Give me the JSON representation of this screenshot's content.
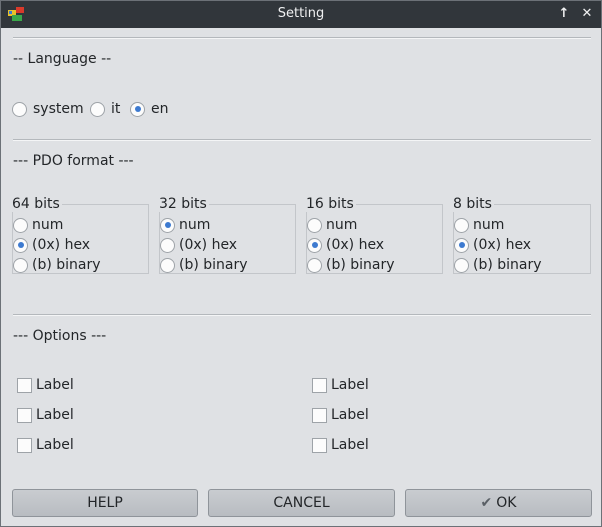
{
  "window": {
    "title": "Setting"
  },
  "language": {
    "section_title": "-- Language --",
    "options": [
      {
        "label": "system",
        "selected": false
      },
      {
        "label": "it",
        "selected": false
      },
      {
        "label": "en",
        "selected": true
      }
    ]
  },
  "pdo": {
    "section_title": "--- PDO format ---",
    "groups": [
      {
        "title": "64 bits",
        "options": [
          "num",
          "(0x) hex",
          "(b) binary"
        ],
        "selected": "(0x) hex"
      },
      {
        "title": "32 bits",
        "options": [
          "num",
          "(0x) hex",
          "(b) binary"
        ],
        "selected": "num"
      },
      {
        "title": "16 bits",
        "options": [
          "num",
          "(0x) hex",
          "(b) binary"
        ],
        "selected": "(0x) hex"
      },
      {
        "title": "8 bits",
        "options": [
          "num",
          "(0x) hex",
          "(b) binary"
        ],
        "selected": "(0x) hex"
      }
    ]
  },
  "options": {
    "section_title": "--- Options ---",
    "checkboxes": [
      "Label",
      "Label",
      "Label",
      "Label",
      "Label",
      "Label"
    ]
  },
  "buttons": {
    "help": "HELP",
    "cancel": "CANCEL",
    "ok": "OK"
  },
  "colors": {
    "titlebar": "#31363b",
    "background": "#dfe1e4",
    "accent": "#3d7ad0"
  }
}
